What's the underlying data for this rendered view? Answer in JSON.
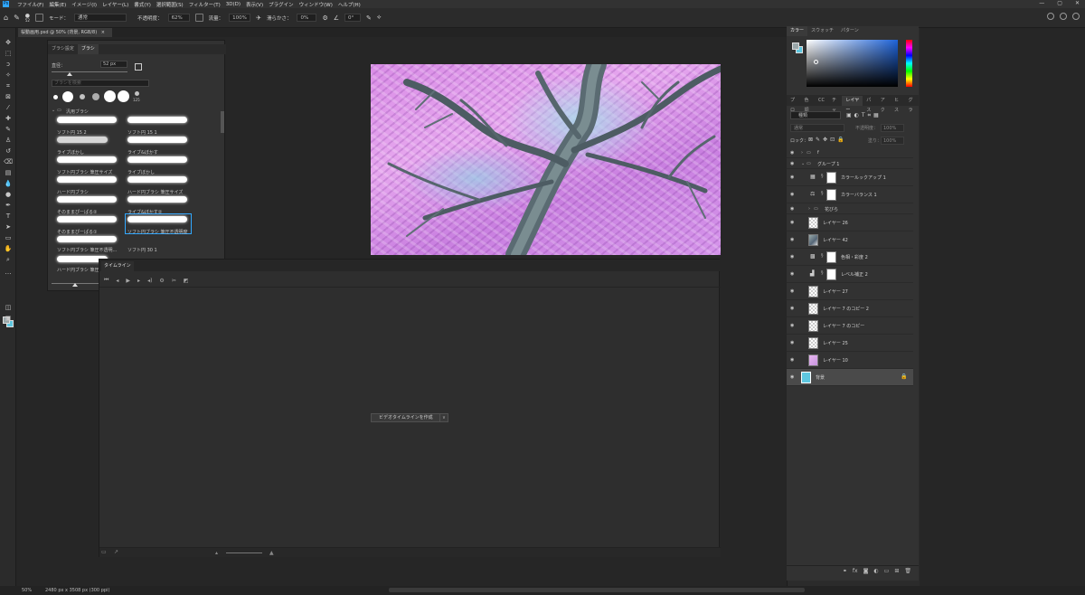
{
  "menubar": {
    "app_badge": "Ps",
    "items": [
      "ファイル(F)",
      "編集(E)",
      "イメージ(I)",
      "レイヤー(L)",
      "書式(Y)",
      "選択範囲(S)",
      "フィルター(T)",
      "3D(D)",
      "表示(V)",
      "プラグイン",
      "ウィンドウ(W)",
      "ヘルプ(H)"
    ],
    "window_buttons": [
      "—",
      "▢",
      "✕"
    ]
  },
  "options_bar": {
    "brush_size": "52",
    "mode_label": "モード：",
    "mode_value": "通常",
    "opacity_label": "不透明度：",
    "opacity_value": "62%",
    "flow_label": "流量：",
    "flow_value": "100%",
    "smoothing_label": "滑らかさ：",
    "smoothing_value": "0%",
    "angle_value": "0°"
  },
  "document_tab": {
    "title": "桜動画用.psd @ 50% (背景, RGB/8)",
    "close": "×"
  },
  "brush_panel": {
    "tabs": [
      "ブラシ設定",
      "ブラシ"
    ],
    "size_label": "直径：",
    "size_value": "52 px",
    "search_placeholder": "ブラシを検索",
    "preset_last_label": "125",
    "group_name": "汎用ブラシ",
    "brushes": [
      {
        "name": "ソフト円 15 2"
      },
      {
        "name": "ソフト円 15 1"
      },
      {
        "name": "ライブぼかし"
      },
      {
        "name": "ライブ&ぼかす"
      },
      {
        "name": "ソフト円ブラシ 筆圧サイズ"
      },
      {
        "name": "ライブぼかし"
      },
      {
        "name": "ハード円ブラシ"
      },
      {
        "name": "ハード円ブラシ 筆圧サイズ"
      },
      {
        "name": "そのままぴーぱる②"
      },
      {
        "name": "ライブ&ぼかす②"
      },
      {
        "name": "そのままぴーぱる①"
      },
      {
        "name": "ソフト円ブラシ 筆圧不透明度"
      },
      {
        "name": "ソフト円ブラシ 筆圧不透明..."
      },
      {
        "name": "ソフト円 30 1"
      },
      {
        "name": "ハード円ブラシ 筆圧..."
      }
    ]
  },
  "timeline": {
    "tab": "タイムライン",
    "create_button": "ビデオタイムラインを作成",
    "dropdown": "∨"
  },
  "color_panel": {
    "tabs": [
      "カラー",
      "スウォッチ",
      "パターン"
    ]
  },
  "layers_panel": {
    "tabs": [
      "プロ",
      "色調",
      "CC",
      "チャ",
      "レイヤー",
      "パス",
      "アク",
      "ヒス",
      "グラ"
    ],
    "kind_label": "種類",
    "blend_mode": "通常",
    "opacity_label": "不透明度：",
    "opacity_value": "100%",
    "lock_label": "ロック：",
    "fill_label": "塗り：",
    "fill_value": "100%",
    "layers": [
      {
        "name": "f"
      },
      {
        "name": "グループ 1"
      },
      {
        "name": "カラールックアップ 1"
      },
      {
        "name": "カラーバランス 1"
      },
      {
        "name": "花びら"
      },
      {
        "name": "レイヤー 26"
      },
      {
        "name": "レイヤー 42"
      },
      {
        "name": "色相・彩度 2"
      },
      {
        "name": "レベル補正 2"
      },
      {
        "name": "レイヤー 27"
      },
      {
        "name": "レイヤー 7 のコピー 2"
      },
      {
        "name": "レイヤー 7 のコピー"
      },
      {
        "name": "レイヤー 25"
      },
      {
        "name": "レイヤー 10"
      },
      {
        "name": "背景"
      }
    ]
  },
  "status_bar": {
    "zoom": "50%",
    "doc_info": "2480 px x 3508 px (300 ppi)"
  },
  "colors": {
    "foreground": "#9aa7a9",
    "background": "#5ec7e0",
    "accent": "#31a8ff"
  }
}
